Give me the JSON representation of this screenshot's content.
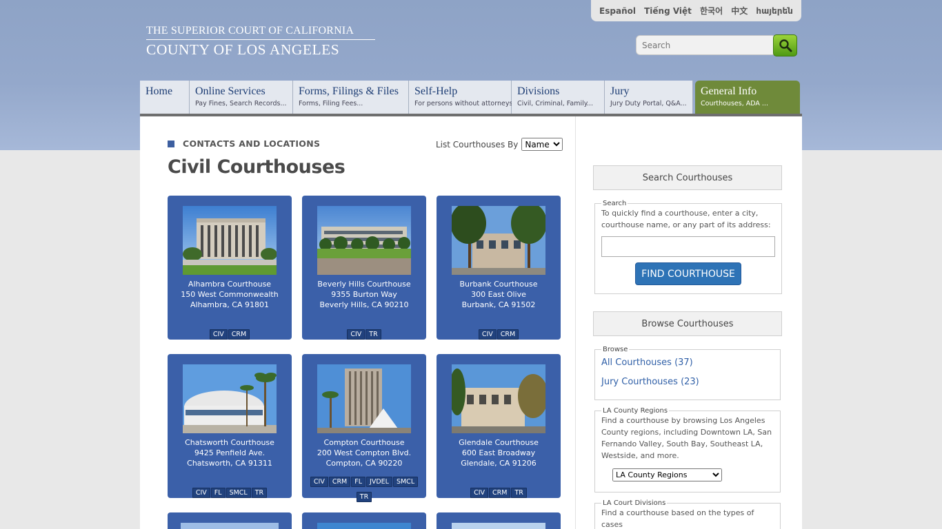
{
  "languages": [
    "Español",
    "Tiếng Việt",
    "한국어",
    "中文",
    "հայերեն"
  ],
  "logo": {
    "line1": "THE SUPERIOR COURT OF CALIFORNIA",
    "line2": "COUNTY OF LOS ANGELES"
  },
  "search": {
    "placeholder": "Search"
  },
  "nav": [
    {
      "title": "Home",
      "sub": ""
    },
    {
      "title": "Online Services",
      "sub": "Pay Fines, Search Records..."
    },
    {
      "title": "Forms, Filings & Files",
      "sub": "Forms, Filing Fees..."
    },
    {
      "title": "Self-Help",
      "sub": "For persons without attorneys"
    },
    {
      "title": "Divisions",
      "sub": "Civil, Criminal, Family..."
    },
    {
      "title": "Jury",
      "sub": "Jury Duty Portal, Q&A..."
    },
    {
      "title": "General Info",
      "sub": "Courthouses, ADA ..."
    }
  ],
  "main": {
    "section": "CONTACTS AND LOCATIONS",
    "list_by_label": "List Courthouses By",
    "list_by_value": "Name",
    "title": "Civil Courthouses"
  },
  "courthouses": [
    {
      "name": "Alhambra Courthouse",
      "addr": "150 West Commonwealth",
      "city": "Alhambra, CA 91801",
      "tags": [
        "CIV",
        "CRM"
      ]
    },
    {
      "name": "Beverly Hills Courthouse",
      "addr": "9355 Burton Way",
      "city": "Beverly Hills, CA 90210",
      "tags": [
        "CIV",
        "TR"
      ]
    },
    {
      "name": "Burbank Courthouse",
      "addr": "300 East Olive",
      "city": "Burbank, CA 91502",
      "tags": [
        "CIV",
        "CRM"
      ]
    },
    {
      "name": "Chatsworth Courthouse",
      "addr": "9425 Penfield Ave.",
      "city": "Chatsworth, CA 91311",
      "tags": [
        "CIV",
        "FL",
        "SMCL",
        "TR"
      ]
    },
    {
      "name": "Compton Courthouse",
      "addr": "200 West Compton Blvd.",
      "city": "Compton, CA 90220",
      "tags": [
        "CIV",
        "CRM",
        "FL",
        "JVDEL",
        "SMCL",
        "TR"
      ]
    },
    {
      "name": "Glendale Courthouse",
      "addr": "600 East Broadway",
      "city": "Glendale, CA 91206",
      "tags": [
        "CIV",
        "CRM",
        "TR"
      ]
    }
  ],
  "sidebar": {
    "search_btn": "Search Courthouses",
    "search_legend": "Search",
    "search_text": "To quickly find a courthouse, enter a city, courthouse name, or any part of its address:",
    "find_btn": "FIND COURTHOUSE",
    "browse_btn": "Browse Courthouses",
    "browse_legend": "Browse",
    "all_link": "All Courthouses (37)",
    "jury_link": "Jury Courthouses (23)",
    "regions_legend": "LA County Regions",
    "regions_text": "Find a courthouse by browsing Los Angeles County regions, including Downtown LA, San Fernando Valley, South Bay, Southeast LA, Westside, and more.",
    "regions_select": "LA County Regions",
    "divisions_legend": "LA Court Divisions",
    "divisions_text": "Find a courthouse based on the types of cases"
  }
}
